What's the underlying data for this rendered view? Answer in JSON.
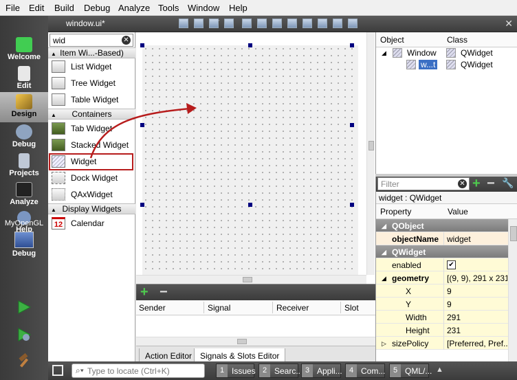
{
  "menubar": {
    "items": [
      "File",
      "Edit",
      "Build",
      "Debug",
      "Analyze",
      "Tools",
      "Window",
      "Help"
    ]
  },
  "document": {
    "title": "window.ui*"
  },
  "modes": [
    {
      "label": "Welcome",
      "icon": "qt-logo-icon"
    },
    {
      "label": "Edit",
      "icon": "edit-document-icon"
    },
    {
      "label": "Design",
      "icon": "design-pencil-icon"
    },
    {
      "label": "Debug",
      "icon": "debug-bug-icon"
    },
    {
      "label": "Projects",
      "icon": "projects-folder-icon"
    },
    {
      "label": "Analyze",
      "icon": "analyze-monitor-icon"
    },
    {
      "label": "Help",
      "icon": "help-question-icon"
    }
  ],
  "kit": {
    "project": "MyOpenGL",
    "build": "Debug"
  },
  "widgetbox": {
    "filter": "wid",
    "categories": {
      "item_widgets": "Item Wi...-Based)",
      "containers": "Containers",
      "display": "Display Widgets"
    },
    "items": {
      "list": "List Widget",
      "tree": "Tree Widget",
      "table": "Table Widget",
      "tab": "Tab Widget",
      "stacked": "Stacked Widget",
      "widget": "Widget",
      "dock": "Dock Widget",
      "qax": "QAxWidget",
      "calendar": "Calendar"
    },
    "calendar_day": "12"
  },
  "signals": {
    "columns": {
      "sender": "Sender",
      "signal": "Signal",
      "receiver": "Receiver",
      "slot": "Slot"
    },
    "tabs": {
      "action": "Action Editor",
      "signals": "Signals & Slots Editor"
    }
  },
  "object_inspector": {
    "headers": {
      "object": "Object",
      "class": "Class"
    },
    "rows": [
      {
        "object": "Window",
        "class": "QWidget"
      },
      {
        "object": "w...t",
        "class": "QWidget"
      }
    ]
  },
  "property_editor": {
    "filter_placeholder": "Filter",
    "subtitle": "widget : QWidget",
    "headers": {
      "property": "Property",
      "value": "Value"
    },
    "groups": {
      "qobject": "QObject",
      "qwidget": "QWidget"
    },
    "props": {
      "objectName": {
        "name": "objectName",
        "value": "widget"
      },
      "enabled": {
        "name": "enabled",
        "value": "✔"
      },
      "geometry": {
        "name": "geometry",
        "value": "[(9, 9), 291 x 231]"
      },
      "x": {
        "name": "X",
        "value": "9"
      },
      "y": {
        "name": "Y",
        "value": "9"
      },
      "width": {
        "name": "Width",
        "value": "291"
      },
      "height": {
        "name": "Height",
        "value": "231"
      },
      "sizePolicy": {
        "name": "sizePolicy",
        "value": "[Preferred, Pref..."
      }
    }
  },
  "statusbar": {
    "locator_placeholder": "Type to locate (Ctrl+K)",
    "tabs": [
      {
        "num": "1",
        "label": "Issues"
      },
      {
        "num": "2",
        "label": "Searc..."
      },
      {
        "num": "3",
        "label": "Appli..."
      },
      {
        "num": "4",
        "label": "Com..."
      },
      {
        "num": "5",
        "label": "QML/..."
      }
    ]
  },
  "colors": {
    "accent_red": "#b71c1c",
    "handle": "#000080",
    "selection": "#3b6fc4",
    "run_green": "#3cb043"
  }
}
